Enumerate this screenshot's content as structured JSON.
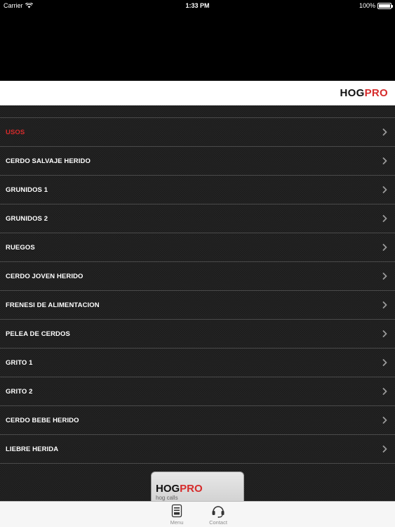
{
  "status_bar": {
    "carrier": "Carrier",
    "time": "1:33 PM",
    "battery_percent": "100%",
    "battery_level": 1.0
  },
  "brand": {
    "logo_part1": "HOG",
    "logo_part2": "PRO",
    "accent_color": "#d62b2b"
  },
  "menu": {
    "items": [
      {
        "label": "USOS",
        "active": true
      },
      {
        "label": "CERDO SALVAJE HERIDO"
      },
      {
        "label": "GRUNIDOS 1"
      },
      {
        "label": "GRUNIDOS 2"
      },
      {
        "label": "RUEGOS"
      },
      {
        "label": "CERDO JOVEN HERIDO"
      },
      {
        "label": "FRENESI DE ALIMENTACION"
      },
      {
        "label": "PELEA DE CERDOS"
      },
      {
        "label": "GRITO 1"
      },
      {
        "label": "GRITO 2"
      },
      {
        "label": "CERDO BEBE HERIDO"
      },
      {
        "label": "LIEBRE HERIDA"
      }
    ],
    "chevron_icon": "chevron-right-icon"
  },
  "promo": {
    "logo_part1": "HOG",
    "logo_part2": "PRO",
    "subtitle": "hog calls"
  },
  "tab_bar": {
    "tabs": [
      {
        "label": "Menu",
        "icon": "menu-list-icon"
      },
      {
        "label": "Contact",
        "icon": "headset-icon"
      }
    ]
  }
}
